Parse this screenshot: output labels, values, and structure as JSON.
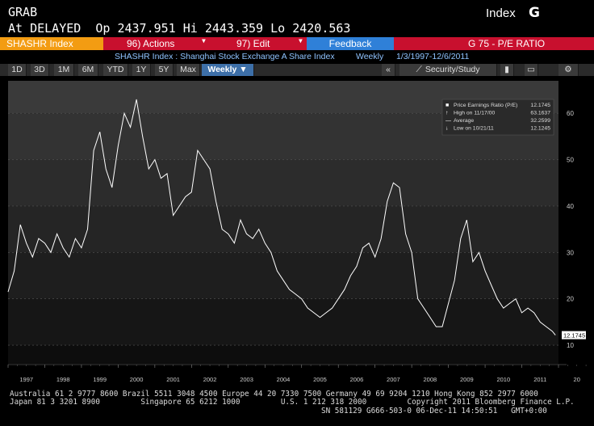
{
  "header": {
    "command": "GRAB",
    "quote_line": "At DELAYED  Op 2437.951 Hi 2443.359 Lo 2420.563",
    "security_type": "Index",
    "logo_letter": "G"
  },
  "menu": {
    "ticker": "SHASHR Index",
    "actions": "96) Actions",
    "edit": "97) Edit",
    "feedback": "Feedback",
    "function": "G 75 - P/E RATIO"
  },
  "info": {
    "security": "SHASHR Index : Shanghai Stock Exchange A Share Index",
    "period": "Weekly",
    "range": "1/3/1997-12/6/2011"
  },
  "toolbar": {
    "buttons": [
      "1D",
      "3D",
      "1M",
      "6M",
      "YTD",
      "1Y",
      "5Y",
      "Max"
    ],
    "period_select": "Weekly ▼",
    "nav": "«",
    "security_study": "Security/Study",
    "gear": "⚙"
  },
  "colors": {
    "accent_red": "#c8102e",
    "orange": "#f39c12",
    "feedback_blue": "#2f80d8",
    "line": "#ffffff"
  },
  "chart_data": {
    "type": "line",
    "series": [
      {
        "name": "Price Earnings Ratio (P/E)",
        "x": [
          "1997-01",
          "1997-03",
          "1997-05",
          "1997-07",
          "1997-09",
          "1997-11",
          "1998-01",
          "1998-03",
          "1998-05",
          "1998-07",
          "1998-09",
          "1998-11",
          "1999-01",
          "1999-03",
          "1999-05",
          "1999-07",
          "1999-09",
          "1999-11",
          "2000-01",
          "2000-03",
          "2000-05",
          "2000-07",
          "2000-09",
          "2000-11",
          "2001-01",
          "2001-03",
          "2001-05",
          "2001-07",
          "2001-09",
          "2001-11",
          "2002-01",
          "2002-03",
          "2002-05",
          "2002-07",
          "2002-09",
          "2002-11",
          "2003-01",
          "2003-03",
          "2003-05",
          "2003-07",
          "2003-09",
          "2003-11",
          "2004-01",
          "2004-03",
          "2004-05",
          "2004-07",
          "2004-09",
          "2004-11",
          "2005-01",
          "2005-03",
          "2005-05",
          "2005-07",
          "2005-09",
          "2005-11",
          "2006-01",
          "2006-03",
          "2006-05",
          "2006-07",
          "2006-09",
          "2006-11",
          "2007-01",
          "2007-03",
          "2007-05",
          "2007-07",
          "2007-09",
          "2007-11",
          "2008-01",
          "2008-03",
          "2008-05",
          "2008-07",
          "2008-09",
          "2008-11",
          "2009-01",
          "2009-03",
          "2009-05",
          "2009-07",
          "2009-09",
          "2009-11",
          "2010-01",
          "2010-03",
          "2010-05",
          "2010-07",
          "2010-09",
          "2010-11",
          "2011-01",
          "2011-03",
          "2011-05",
          "2011-07",
          "2011-09",
          "2011-11",
          "2011-12"
        ],
        "values": [
          21.5,
          26,
          36,
          32,
          29,
          33,
          32,
          30,
          34,
          31,
          29,
          33,
          31,
          35,
          52,
          56,
          48,
          44,
          53,
          60,
          57,
          63,
          55,
          48,
          50,
          46,
          47,
          38,
          40,
          42,
          43,
          52,
          50,
          48,
          41,
          35,
          34,
          32,
          37,
          34,
          33,
          35,
          32,
          30,
          26,
          24,
          22,
          21,
          20,
          18,
          17,
          16,
          17,
          18,
          20,
          22,
          25,
          27,
          31,
          32,
          29,
          33,
          41,
          45,
          44,
          34,
          30,
          20,
          18,
          16,
          14,
          14,
          19,
          24,
          33,
          37,
          28,
          30,
          26,
          23,
          20,
          18,
          19,
          20,
          17,
          18,
          17,
          15,
          14,
          13,
          12.17
        ]
      }
    ],
    "xlabel": "",
    "ylabel": "",
    "x_ticks": [
      "1997",
      "1998",
      "1999",
      "2000",
      "2001",
      "2002",
      "2003",
      "2004",
      "2005",
      "2006",
      "2007",
      "2008",
      "2009",
      "2010",
      "2011",
      "20"
    ],
    "y_ticks": [
      10,
      20,
      30,
      40,
      50,
      60
    ],
    "ylim": [
      6,
      67
    ],
    "last_value_label": "12.1745",
    "legend": {
      "placement": "top-right",
      "rows": [
        {
          "label": "Price Earnings Ratio (P/E)",
          "value": "12.1745"
        },
        {
          "label": "High on 11/17/00",
          "value": "63.1637"
        },
        {
          "label": "Average",
          "value": "32.2599"
        },
        {
          "label": "Low on 10/21/11",
          "value": "12.1245"
        }
      ]
    }
  },
  "footer": {
    "line1": "Australia 61 2 9777 8600 Brazil 5511 3048 4500 Europe 44 20 7330 7500 Germany 49 69 9204 1210 Hong Kong 852 2977 6000",
    "line2": "Japan 81 3 3201 8900         Singapore 65 6212 1000         U.S. 1 212 318 2000         Copyright 2011 Bloomberg Finance L.P.",
    "line3": "SN 581129 G666-503-0 06-Dec-11 14:50:51   GMT+0:00"
  }
}
